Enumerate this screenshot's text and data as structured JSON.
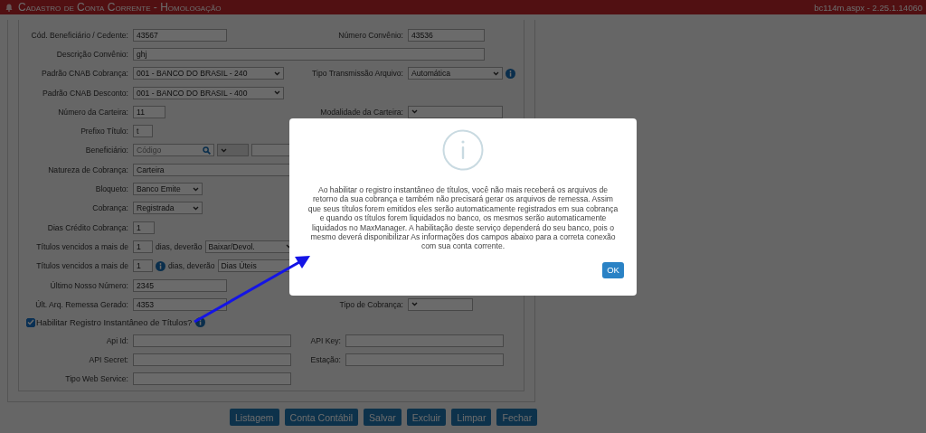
{
  "header": {
    "title": "Cadastro de Conta Corrente  - Homologação",
    "version": "bc114m.aspx - 2.25.1.14060"
  },
  "form": {
    "rows": [
      {
        "kind": "standard",
        "label": "Cód. Beneficiário / Cedente:",
        "controls": [
          {
            "kind": "input",
            "value": "43567"
          }
        ],
        "right": {
          "label": "Número Convênio:",
          "controls": [
            {
              "kind": "input",
              "value": "43536"
            }
          ]
        }
      },
      {
        "kind": "standard",
        "label": "Descrição Convênio:",
        "controls": [
          {
            "kind": "input",
            "value": "ghj"
          }
        ]
      },
      {
        "kind": "standard",
        "label": "Padrão CNAB Cobrança:",
        "controls": [
          {
            "kind": "select",
            "value": "001 - BANCO DO BRASIL - 240"
          }
        ],
        "right": {
          "label": "Tipo Transmissão Arquivo:",
          "controls": [
            {
              "kind": "select",
              "value": "Automática"
            },
            {
              "kind": "info"
            }
          ]
        }
      },
      {
        "kind": "standard",
        "label": "Padrão CNAB Desconto:",
        "controls": [
          {
            "kind": "select",
            "value": "001 - BANCO DO BRASIL - 400"
          }
        ]
      },
      {
        "kind": "standard",
        "label": "Número da Carteira:",
        "controls": [
          {
            "kind": "input",
            "value": "11"
          }
        ],
        "right": {
          "label": "Modalidade da Carteira:",
          "controls": [
            {
              "kind": "select"
            }
          ]
        }
      },
      {
        "kind": "standard",
        "label": "Prefixo Título:",
        "controls": [
          {
            "kind": "input",
            "value": "t"
          }
        ]
      },
      {
        "kind": "standard",
        "label": "Beneficiário:",
        "controls": [
          {
            "kind": "lookup",
            "placeholder": "Código"
          },
          {
            "kind": "select",
            "disabled": true
          },
          {
            "kind": "input"
          }
        ]
      },
      {
        "kind": "standard",
        "label": "Natureza de Cobrança:",
        "controls": [
          {
            "kind": "input",
            "value": "Carteira"
          }
        ]
      },
      {
        "kind": "standard",
        "label": "Bloqueto:",
        "controls": [
          {
            "kind": "select",
            "value": "Banco Emite"
          }
        ]
      },
      {
        "kind": "standard",
        "label": "Cobrança:",
        "controls": [
          {
            "kind": "select",
            "value": "Registrada"
          }
        ]
      },
      {
        "kind": "standard",
        "label": "Dias Crédito Cobrança:",
        "controls": [
          {
            "kind": "input",
            "value": "1"
          }
        ]
      },
      {
        "kind": "standard",
        "label": "Títulos vencidos a mais de",
        "controls": [
          {
            "kind": "input",
            "value": "1"
          },
          {
            "kind": "text",
            "text": "dias, deverão"
          },
          {
            "kind": "select",
            "value": "Baixar/Devol."
          }
        ]
      },
      {
        "kind": "standard",
        "label": "Títulos vencidos a mais de",
        "controls": [
          {
            "kind": "input",
            "value": "1"
          },
          {
            "kind": "info"
          },
          {
            "kind": "text",
            "text": "dias, deverão"
          },
          {
            "kind": "input",
            "value": "Dias Úteis"
          }
        ]
      },
      {
        "kind": "standard",
        "label": "Último Nosso Número:",
        "controls": [
          {
            "kind": "input",
            "value": "2345"
          }
        ]
      },
      {
        "kind": "standard",
        "label": "Últ. Arq. Remessa Gerado:",
        "controls": [
          {
            "kind": "input",
            "value": "4353"
          }
        ],
        "right": {
          "label": "Tipo de Cobrança:",
          "controls": [
            {
              "kind": "select"
            }
          ]
        }
      },
      {
        "kind": "checkbox",
        "label": "Habilitar Registro Instantâneo de Títulos?",
        "checked": true
      },
      {
        "kind": "api",
        "label": "Api Id:",
        "controls": [
          {
            "kind": "input"
          }
        ],
        "right": {
          "label": "API Key:",
          "controls": [
            {
              "kind": "input"
            }
          ]
        }
      },
      {
        "kind": "api",
        "label": "API Secret:",
        "controls": [
          {
            "kind": "input"
          }
        ],
        "right": {
          "label": "Estação:",
          "controls": [
            {
              "kind": "input"
            }
          ]
        }
      },
      {
        "kind": "api",
        "label": "Tipo Web Service:",
        "controls": [
          {
            "kind": "input"
          }
        ]
      }
    ]
  },
  "buttons": [
    "Listagem",
    "Conta Contábil",
    "Salvar",
    "Excluir",
    "Limpar",
    "Fechar"
  ],
  "dialog": {
    "message": "Ao habilitar o registro instantâneo de títulos, você não mais receberá os arquivos de retorno da sua cobrança e também não precisará gerar os arquivos de remessa. Assim que seus títulos forem emitidos eles serão automaticamente registrados em sua cobrança e quando os títulos forem liquidados no banco, os mesmos serão automaticamente liquidados no MaxManager. A habilitação deste serviço dependerá do seu banco, pois o mesmo deverá disponibilizar As informações dos campos abaixo para a correta conexão com sua conta corrente.",
    "ok": "OK"
  }
}
